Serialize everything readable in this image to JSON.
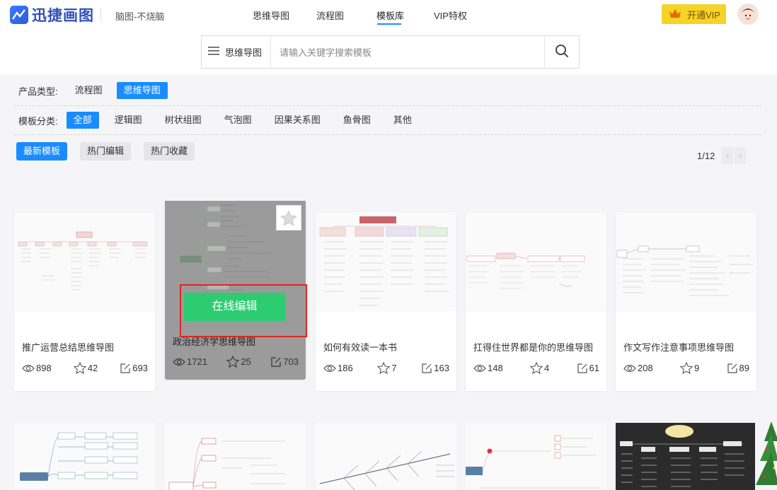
{
  "header": {
    "logo_text": "迅捷画图",
    "slogan": "脑图-不烧脑",
    "nav": [
      "思维导图",
      "流程图",
      "模板库",
      "VIP特权"
    ],
    "active_nav": "模板库",
    "vip_label": "开通VIP"
  },
  "search": {
    "category": "思维导图",
    "placeholder": "请输入关键字搜索模板"
  },
  "filters": {
    "product_label": "产品类型:",
    "product_types": [
      "流程图",
      "思维导图"
    ],
    "product_selected": "思维导图",
    "category_label": "模板分类:",
    "categories": [
      "全部",
      "逻辑图",
      "树状组图",
      "气泡图",
      "因果关系图",
      "鱼骨图",
      "其他"
    ],
    "category_selected": "全部",
    "sort_options": [
      "最新模板",
      "热门编辑",
      "热门收藏"
    ],
    "sort_selected": "最新模板"
  },
  "pager": {
    "text": "1/12",
    "prev": "‹",
    "next": "›"
  },
  "cards": [
    {
      "title": "推广运营总结思维导图",
      "views": "898",
      "stars": "42",
      "edits": "693"
    },
    {
      "title": "政治经济学思维导图",
      "views": "1721",
      "stars": "25",
      "edits": "703",
      "action": "在线编辑"
    },
    {
      "title": "如何有效读一本书",
      "views": "186",
      "stars": "7",
      "edits": "163"
    },
    {
      "title": "扛得住世界都是你的思维导图",
      "views": "148",
      "stars": "4",
      "edits": "61"
    },
    {
      "title": "作文写作注意事项思维导图",
      "views": "208",
      "stars": "9",
      "edits": "89"
    }
  ],
  "colors": {
    "accent": "#1a8cff",
    "vip": "#f5d327",
    "edit": "#2ecc71",
    "highlight": "#e02424"
  }
}
